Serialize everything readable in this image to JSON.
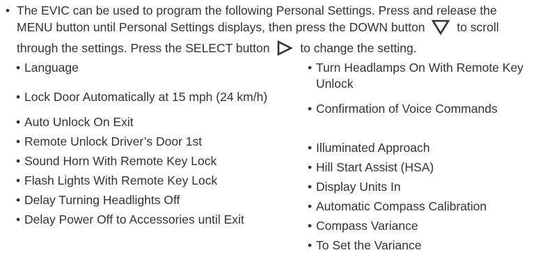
{
  "intro": {
    "bullet": "•",
    "part1": "The EVIC can be used to program the following Personal Settings. Press and release the MENU button until Personal Settings displays, then press the DOWN button",
    "part2": "to scroll through the settings. Press the SELECT button",
    "part3": "to change the setting.",
    "down_icon": "down-triangle-icon",
    "select_icon": "right-triangle-icon"
  },
  "settings_left": [
    "Language",
    "Lock Door Automatically at 15 mph (24 km/h)",
    "Auto Unlock On Exit",
    "Remote Unlock Driver’s Door 1st",
    "Sound Horn With Remote Key Lock",
    "Flash Lights With Remote Key Lock",
    "Delay Turning Headlights Off",
    "Delay Power Off to Accessories until Exit"
  ],
  "settings_right": [
    "Turn Headlamps On With Remote Key Unlock",
    "Confirmation of Voice Commands",
    "Illuminated Approach",
    "Hill Start Assist (HSA)",
    "Display Units In",
    "Automatic Compass Calibration",
    "Compass Variance",
    "To Set the Variance"
  ],
  "bullet_char": "•"
}
